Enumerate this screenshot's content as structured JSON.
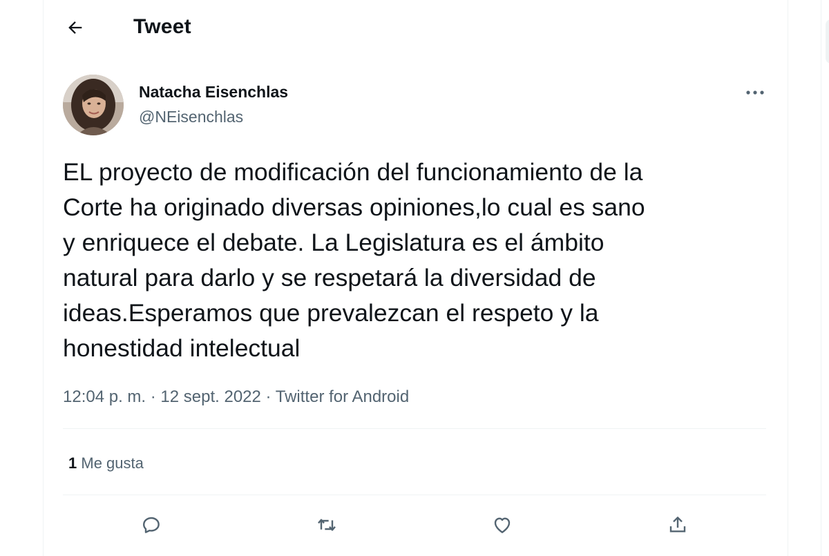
{
  "header": {
    "title": "Tweet",
    "back_icon": "arrow-left-icon"
  },
  "tweet": {
    "author": {
      "name": "Natacha Eisenchlas",
      "handle": "@NEisenchlas"
    },
    "text": "EL proyecto de modificación del funcionamiento de la\nCorte  ha originado diversas opiniones,lo cual es sano\ny enriquece el debate. La Legislatura es el ámbito\nnatural para darlo y se respetará la diversidad de\nideas.Esperamos que prevalezcan el respeto y la\nhonestidad intelectual",
    "time": "12:04 p. m.",
    "separator": " · ",
    "date": "12 sept. 2022",
    "source": "Twitter for Android",
    "likes_count": "1",
    "likes_label": "Me gusta"
  },
  "actions": {
    "reply_icon": "reply-icon",
    "retweet_icon": "retweet-icon",
    "like_icon": "heart-icon",
    "share_icon": "share-icon",
    "more_icon": "more-icon"
  },
  "colors": {
    "text": "#0f1419",
    "secondary": "#536471",
    "divider": "#eff3f4"
  }
}
